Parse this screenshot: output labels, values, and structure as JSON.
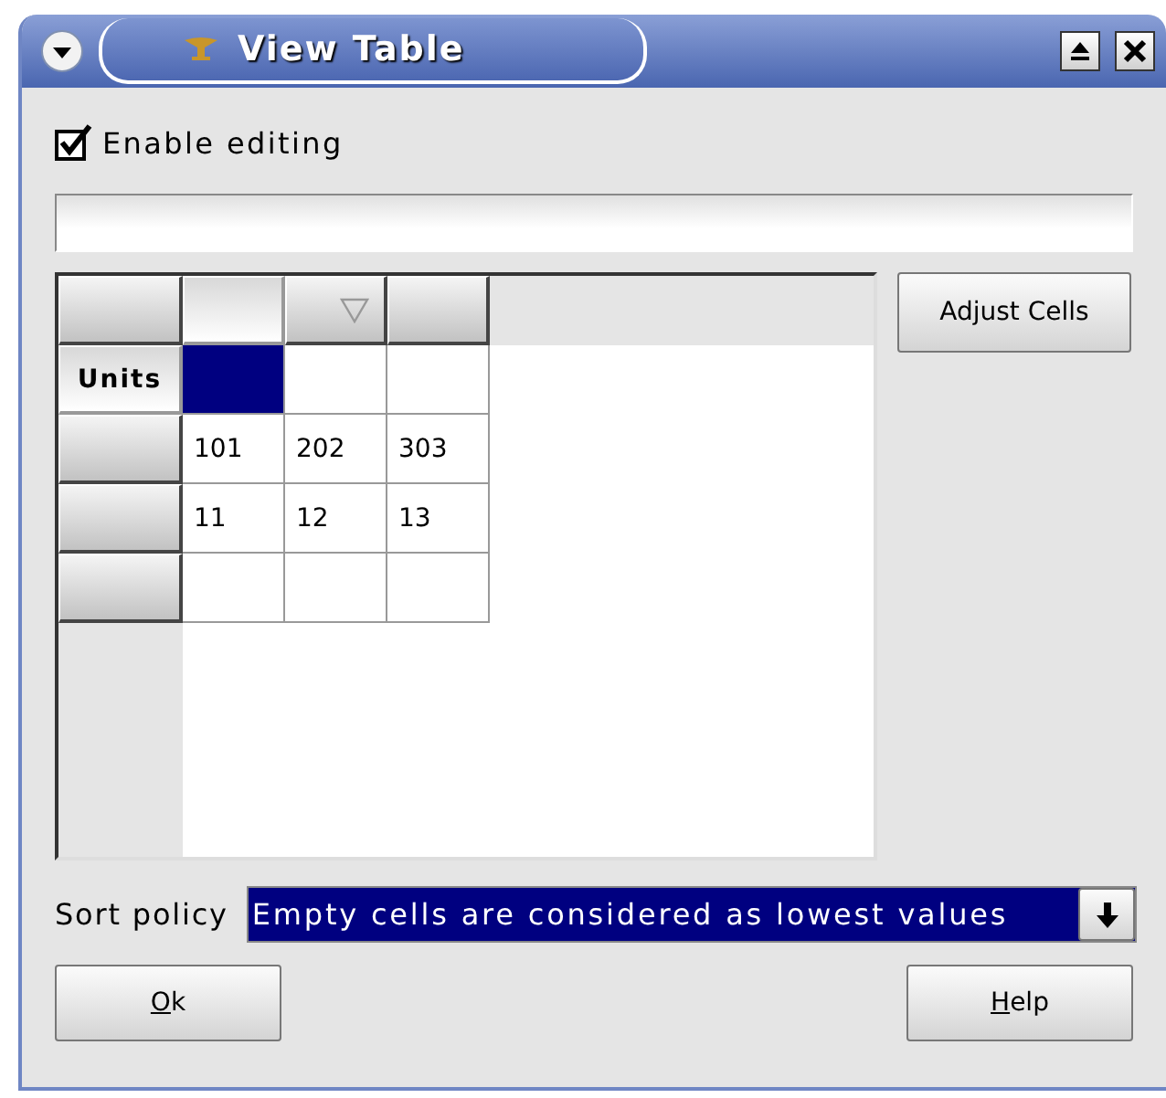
{
  "window": {
    "title": "View Table"
  },
  "enable_editing": {
    "label": "Enable editing",
    "checked": true
  },
  "table": {
    "columns": [
      {
        "current": true,
        "sorted": false
      },
      {
        "current": false,
        "sorted": true
      },
      {
        "current": false,
        "sorted": false
      }
    ],
    "rows": [
      {
        "label": "Units",
        "current": true,
        "cells": [
          {
            "selected": true
          },
          {
            "selected": false
          },
          {
            "selected": false
          }
        ]
      },
      {
        "current": false,
        "cells": [
          {
            "text": "101",
            "selected": false
          },
          {
            "text": "202",
            "selected": false
          },
          {
            "text": "303",
            "selected": false
          }
        ]
      },
      {
        "current": false,
        "cells": [
          {
            "text": "11",
            "selected": false
          },
          {
            "text": "12",
            "selected": false
          },
          {
            "text": "13",
            "selected": false
          }
        ]
      },
      {
        "current": false,
        "cells": [
          {
            "selected": false
          },
          {
            "selected": false
          },
          {
            "selected": false
          }
        ]
      }
    ]
  },
  "adjust_button": {
    "label": "Adjust Cells"
  },
  "sort_policy": {
    "label": "Sort policy",
    "value": "Empty cells are considered as lowest values"
  },
  "buttons": [
    {
      "label": "Ok",
      "underline_first": true
    },
    {
      "label": "Help",
      "underline_first": true
    }
  ]
}
